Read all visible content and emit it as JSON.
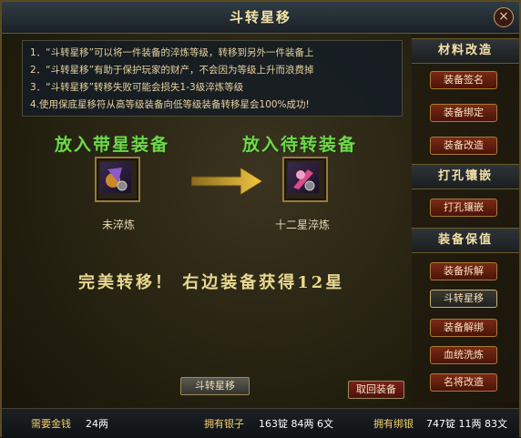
{
  "window": {
    "title": "斗转星移",
    "close_label": "×"
  },
  "notes": [
    "1．“斗转星移”可以将一件装备的淬炼等级，转移到另外一件装备上",
    "2．“斗转星移”有助于保护玩家的财产，不会因为等级上升而浪费掉",
    "3．“斗转星移”转移失败可能会损失1-3级淬炼等级",
    "4.使用保底星移符从高等级装备向低等级装备转移星会100%成功!"
  ],
  "transfer": {
    "left_label": "放入带星装备",
    "right_label": "放入待转装备",
    "left_item_name": "未淬炼",
    "right_item_name": "十二星淬炼",
    "result_text": "完美转移！ 右边装备获得12星",
    "main_button": "斗转星移",
    "cancel_button": "取回装备"
  },
  "sidebar": {
    "sections": [
      {
        "title": "材料改造",
        "buttons": [
          "装备签名",
          "装备绑定",
          "装备改造"
        ]
      },
      {
        "title": "打孔镶嵌",
        "buttons": [
          "打孔镶嵌"
        ]
      },
      {
        "title": "装备保值",
        "buttons": [
          "装备拆解",
          "斗转星移",
          "装备解绑",
          "血统洗炼",
          "名将改造"
        ]
      }
    ],
    "active_button": "斗转星移"
  },
  "footer": {
    "cost_label": "需要金钱",
    "cost_value": "24两",
    "silver_label": "拥有银子",
    "silver_value": "163锭 84两 6文",
    "bound_label": "拥有绑银",
    "bound_value": "747锭 11两 83文"
  },
  "colors": {
    "slot_label": "#6fd84a",
    "result": "#e8d890",
    "note": "#e6d2a0"
  }
}
